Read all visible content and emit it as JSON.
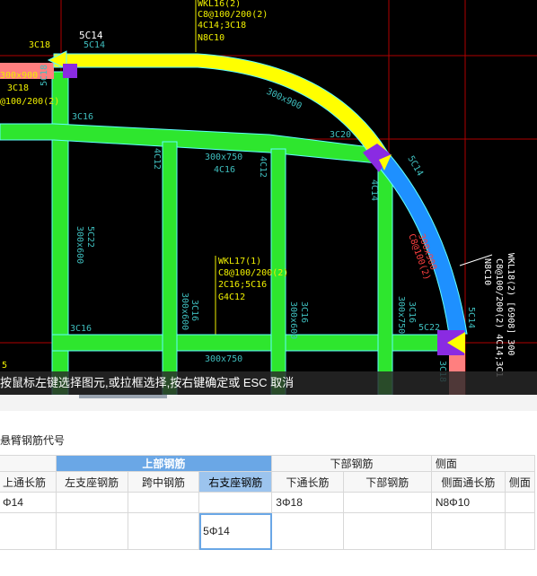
{
  "cad": {
    "labels": {
      "top_left_3c18": "3C18",
      "top_5c14_white": "5C14",
      "top_5c14_cyan": "5C14",
      "kl_top_1": "WKL16(2)",
      "kl_top_2": "C8@100/200(2)",
      "kl_top_3": "4C14;3C18",
      "kl_top_4": "N8C10",
      "left_beam_1": "300x900",
      "left_beam_2": "3C18",
      "left_beam_3": "@100/200(2)",
      "left_5c18": "5C18",
      "label_300x900": "300x900",
      "label_3c16_a": "3C16",
      "label_3c20": "3C20",
      "label_4c12_a": "4C12",
      "label_300x750_a": "300x750",
      "label_4c16": "4C16",
      "label_4c12_b": "4C12",
      "label_4c14": "4C14",
      "label_5c14_diag": "5C14",
      "label_300x600_a": "300x600",
      "label_5c22_a": "5C22",
      "kl17_1": "WKL17(1)",
      "kl17_2": "C8@100/200(2)",
      "kl17_3": "2C16;5C16",
      "kl17_4": "G4C12",
      "label_300x600_b": "300x600",
      "label_3c16_b": "3C16",
      "label_300x600_c": "300x600",
      "label_3c16_c": "3C16",
      "label_300x750_b": "300x750",
      "label_3c16_d": "3C16",
      "label_300x750_c": "300x750",
      "label_3c16_e": "3C16",
      "label_5c22_b": "5C22",
      "label_3c16_f": "3C16",
      "label_300x750_d": "300x750",
      "arc_300x900": "300x900",
      "arc_c8": "C8@100(2)",
      "arc_5c14": "5C14",
      "right_kl_1": "WKL18(2) [6908] 300",
      "right_kl_2": "C8@100/200(2) 4C14;3C1",
      "right_kl_3": "N8C10",
      "bottom_3c18": "3C18",
      "bottom_left_tag": "5"
    },
    "colors": {
      "green": "#2ee62e",
      "yellow": "#ffff00",
      "blue": "#1e90ff",
      "purple": "#8a2be2",
      "pink": "#ff7f7f",
      "grid_red": "#b00000",
      "text_cyan": "#3fbfbf",
      "text_yellow": "#f0f000"
    }
  },
  "status_bar": {
    "text": "按鼠标左键选择图元,或拉框选择,按右键确定或 ESC 取消"
  },
  "panel": {
    "title": "悬臂钢筋代号",
    "group_headers": {
      "top_rebar": "上部钢筋",
      "bottom_rebar": "下部钢筋",
      "side_rebar": "侧面"
    },
    "columns": {
      "top_continuous": "上通长筋",
      "left_support": "左支座钢筋",
      "mid_span": "跨中钢筋",
      "right_support": "右支座钢筋",
      "bottom_continuous": "下通长筋",
      "bottom_rebar": "下部钢筋",
      "side_continuous": "侧面通长筋",
      "side_more": "侧面"
    },
    "rows": [
      {
        "top_continuous": "Φ14",
        "left_support": "",
        "mid_span": "",
        "right_support": "",
        "bottom_continuous": "3Φ18",
        "bottom_rebar": "",
        "side_continuous": "N8Φ10",
        "side_more": ""
      },
      {
        "top_continuous": "",
        "left_support": "",
        "mid_span": "",
        "right_support": "5Φ14",
        "bottom_continuous": "",
        "bottom_rebar": "",
        "side_continuous": "",
        "side_more": ""
      }
    ]
  }
}
